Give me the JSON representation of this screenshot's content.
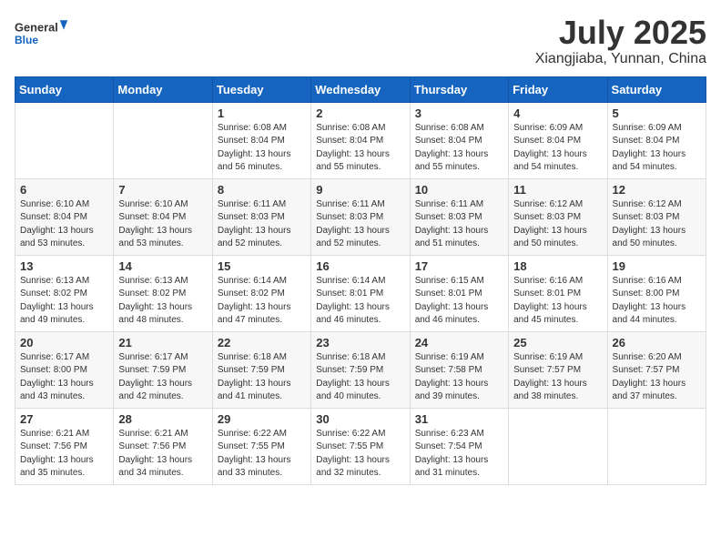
{
  "header": {
    "logo_general": "General",
    "logo_blue": "Blue",
    "month_year": "July 2025",
    "location": "Xiangjiaba, Yunnan, China"
  },
  "weekdays": [
    "Sunday",
    "Monday",
    "Tuesday",
    "Wednesday",
    "Thursday",
    "Friday",
    "Saturday"
  ],
  "weeks": [
    [
      {
        "day": "",
        "info": ""
      },
      {
        "day": "",
        "info": ""
      },
      {
        "day": "1",
        "info": "Sunrise: 6:08 AM\nSunset: 8:04 PM\nDaylight: 13 hours and 56 minutes."
      },
      {
        "day": "2",
        "info": "Sunrise: 6:08 AM\nSunset: 8:04 PM\nDaylight: 13 hours and 55 minutes."
      },
      {
        "day": "3",
        "info": "Sunrise: 6:08 AM\nSunset: 8:04 PM\nDaylight: 13 hours and 55 minutes."
      },
      {
        "day": "4",
        "info": "Sunrise: 6:09 AM\nSunset: 8:04 PM\nDaylight: 13 hours and 54 minutes."
      },
      {
        "day": "5",
        "info": "Sunrise: 6:09 AM\nSunset: 8:04 PM\nDaylight: 13 hours and 54 minutes."
      }
    ],
    [
      {
        "day": "6",
        "info": "Sunrise: 6:10 AM\nSunset: 8:04 PM\nDaylight: 13 hours and 53 minutes."
      },
      {
        "day": "7",
        "info": "Sunrise: 6:10 AM\nSunset: 8:04 PM\nDaylight: 13 hours and 53 minutes."
      },
      {
        "day": "8",
        "info": "Sunrise: 6:11 AM\nSunset: 8:03 PM\nDaylight: 13 hours and 52 minutes."
      },
      {
        "day": "9",
        "info": "Sunrise: 6:11 AM\nSunset: 8:03 PM\nDaylight: 13 hours and 52 minutes."
      },
      {
        "day": "10",
        "info": "Sunrise: 6:11 AM\nSunset: 8:03 PM\nDaylight: 13 hours and 51 minutes."
      },
      {
        "day": "11",
        "info": "Sunrise: 6:12 AM\nSunset: 8:03 PM\nDaylight: 13 hours and 50 minutes."
      },
      {
        "day": "12",
        "info": "Sunrise: 6:12 AM\nSunset: 8:03 PM\nDaylight: 13 hours and 50 minutes."
      }
    ],
    [
      {
        "day": "13",
        "info": "Sunrise: 6:13 AM\nSunset: 8:02 PM\nDaylight: 13 hours and 49 minutes."
      },
      {
        "day": "14",
        "info": "Sunrise: 6:13 AM\nSunset: 8:02 PM\nDaylight: 13 hours and 48 minutes."
      },
      {
        "day": "15",
        "info": "Sunrise: 6:14 AM\nSunset: 8:02 PM\nDaylight: 13 hours and 47 minutes."
      },
      {
        "day": "16",
        "info": "Sunrise: 6:14 AM\nSunset: 8:01 PM\nDaylight: 13 hours and 46 minutes."
      },
      {
        "day": "17",
        "info": "Sunrise: 6:15 AM\nSunset: 8:01 PM\nDaylight: 13 hours and 46 minutes."
      },
      {
        "day": "18",
        "info": "Sunrise: 6:16 AM\nSunset: 8:01 PM\nDaylight: 13 hours and 45 minutes."
      },
      {
        "day": "19",
        "info": "Sunrise: 6:16 AM\nSunset: 8:00 PM\nDaylight: 13 hours and 44 minutes."
      }
    ],
    [
      {
        "day": "20",
        "info": "Sunrise: 6:17 AM\nSunset: 8:00 PM\nDaylight: 13 hours and 43 minutes."
      },
      {
        "day": "21",
        "info": "Sunrise: 6:17 AM\nSunset: 7:59 PM\nDaylight: 13 hours and 42 minutes."
      },
      {
        "day": "22",
        "info": "Sunrise: 6:18 AM\nSunset: 7:59 PM\nDaylight: 13 hours and 41 minutes."
      },
      {
        "day": "23",
        "info": "Sunrise: 6:18 AM\nSunset: 7:59 PM\nDaylight: 13 hours and 40 minutes."
      },
      {
        "day": "24",
        "info": "Sunrise: 6:19 AM\nSunset: 7:58 PM\nDaylight: 13 hours and 39 minutes."
      },
      {
        "day": "25",
        "info": "Sunrise: 6:19 AM\nSunset: 7:57 PM\nDaylight: 13 hours and 38 minutes."
      },
      {
        "day": "26",
        "info": "Sunrise: 6:20 AM\nSunset: 7:57 PM\nDaylight: 13 hours and 37 minutes."
      }
    ],
    [
      {
        "day": "27",
        "info": "Sunrise: 6:21 AM\nSunset: 7:56 PM\nDaylight: 13 hours and 35 minutes."
      },
      {
        "day": "28",
        "info": "Sunrise: 6:21 AM\nSunset: 7:56 PM\nDaylight: 13 hours and 34 minutes."
      },
      {
        "day": "29",
        "info": "Sunrise: 6:22 AM\nSunset: 7:55 PM\nDaylight: 13 hours and 33 minutes."
      },
      {
        "day": "30",
        "info": "Sunrise: 6:22 AM\nSunset: 7:55 PM\nDaylight: 13 hours and 32 minutes."
      },
      {
        "day": "31",
        "info": "Sunrise: 6:23 AM\nSunset: 7:54 PM\nDaylight: 13 hours and 31 minutes."
      },
      {
        "day": "",
        "info": ""
      },
      {
        "day": "",
        "info": ""
      }
    ]
  ]
}
